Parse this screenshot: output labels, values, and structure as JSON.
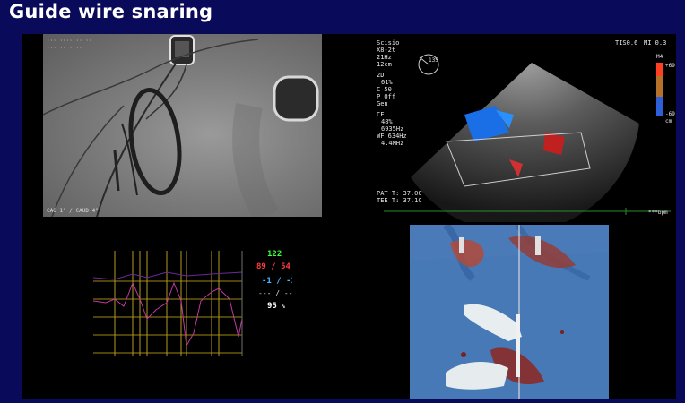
{
  "slide": {
    "title": "Guide wire snaring"
  },
  "fluoro": {
    "projection": "CAO 1° / CAUD 4°"
  },
  "echo": {
    "preset": "Scisio",
    "probe": "X8-2t",
    "framerate": "21Hz",
    "depth": "12cm",
    "mode_2d": "2D",
    "gain_2d": "61%",
    "compress": "C 50",
    "persist": "P Off",
    "gen": "Gen",
    "cf": "CF",
    "cf_gain": "48%",
    "cf_freq": "6935Hz",
    "wf": "WF 634Hz",
    "cf_mhz": "4.4MHz",
    "angle": "135",
    "tis": "TIS0.6",
    "mi": "MI 0.3",
    "scale_top": "M4",
    "scale_max": "+69",
    "scale_min": "-69",
    "scale_unit": "cm",
    "pat_t": "PAT T: 37.0C",
    "tee_t": "TEE T: 37.1C",
    "bpm": "***bpm"
  },
  "vitals": {
    "hr": "122",
    "bp": "89 / 54",
    "p2": "-1 / -1",
    "p3": "--- / ---",
    "spo2": "95",
    "spo2_unit": "%"
  },
  "colors": {
    "background": "#0a0a5a",
    "title": "#ffffff",
    "hr": "#3cff3c",
    "bp": "#ff3b3b",
    "cvp": "#48b8ff",
    "spo2": "#ffffff"
  }
}
